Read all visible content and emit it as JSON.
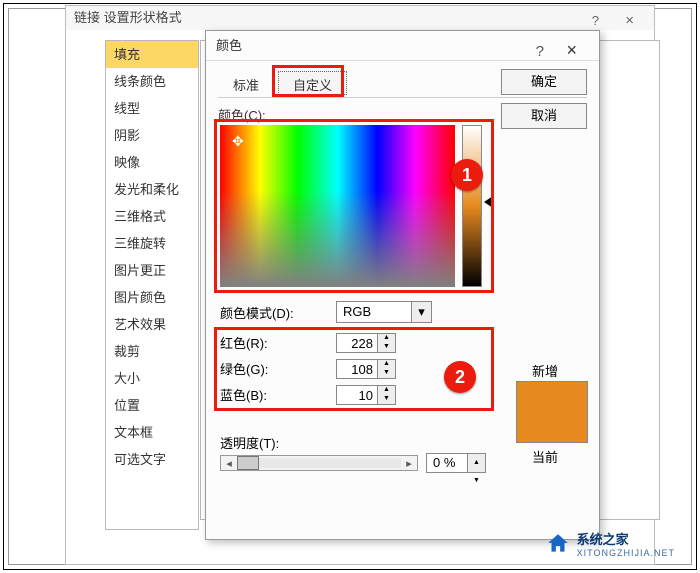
{
  "format_dialog": {
    "title": "链接 设置形状格式",
    "help": "?",
    "close": "×"
  },
  "sidebar": {
    "items": [
      "填充",
      "线条颜色",
      "线型",
      "阴影",
      "映像",
      "发光和柔化",
      "三维格式",
      "三维旋转",
      "图片更正",
      "图片颜色",
      "艺术效果",
      "裁剪",
      "大小",
      "位置",
      "文本框",
      "可选文字"
    ],
    "active_index": 0
  },
  "color_dialog": {
    "title": "颜色",
    "help": "?",
    "close": "×",
    "tabs": {
      "standard": "标准",
      "custom": "自定义"
    },
    "ok": "确定",
    "cancel": "取消",
    "colors_label": "颜色(C):",
    "mode_label": "颜色模式(D):",
    "mode_value": "RGB",
    "rgb": {
      "r_label": "红色(R):",
      "r_value": "228",
      "g_label": "绿色(G):",
      "g_value": "108",
      "b_label": "蓝色(B):",
      "b_value": "10"
    },
    "new_label": "新增",
    "current_label": "当前",
    "swatch_hex": "#e68a1f",
    "transparency_label": "透明度(T):",
    "transparency_value": "0 %",
    "badges": {
      "one": "1",
      "two": "2"
    }
  },
  "watermark": {
    "name": "系统之家",
    "url": "XITONGZHIJIA.NET"
  }
}
